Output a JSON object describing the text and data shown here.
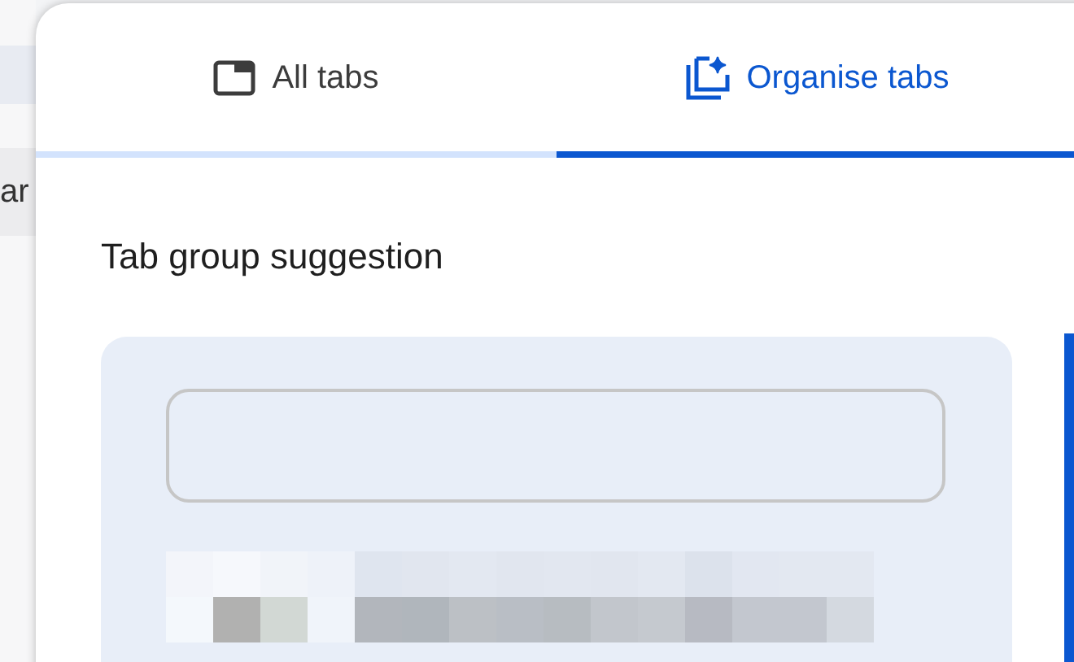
{
  "background_page": {
    "text": "ar"
  },
  "tabs": [
    {
      "label": "All tabs",
      "kind": "list",
      "selected": false
    },
    {
      "label": "Organise tabs",
      "kind": "organise",
      "selected": true
    }
  ],
  "heading": "Tab group suggestion"
}
